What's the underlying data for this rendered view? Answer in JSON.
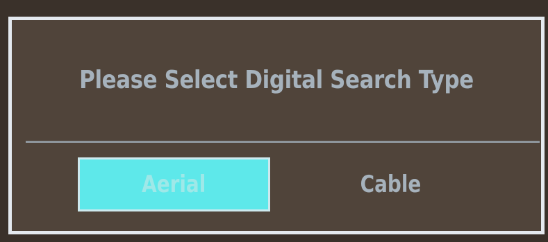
{
  "dialog": {
    "title": "Please Select Digital Search Type",
    "options": [
      {
        "label": "Aerial",
        "selected": true
      },
      {
        "label": "Cable",
        "selected": false
      }
    ]
  },
  "colors": {
    "background": "#50443a",
    "border": "#e4e9ef",
    "text": "#a6b2bc",
    "selected_background": "#5ee8ea"
  }
}
